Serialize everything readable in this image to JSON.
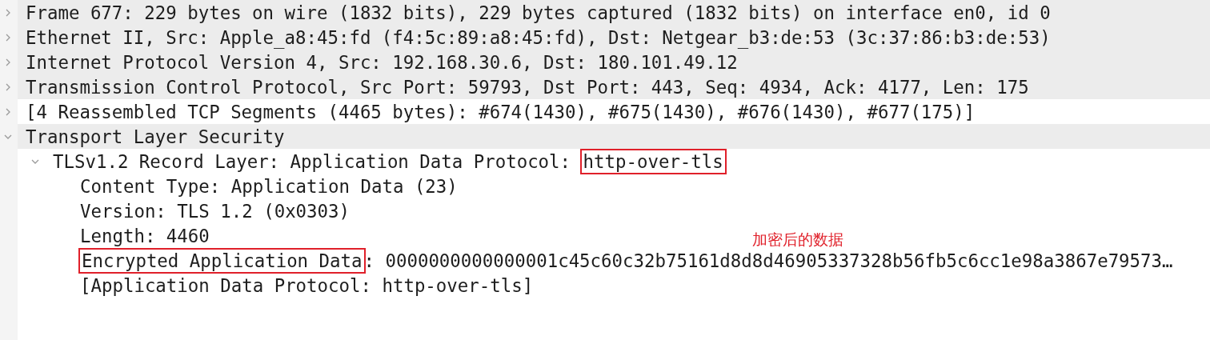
{
  "tree": [
    {
      "expanded": false,
      "shaded": true,
      "segments": [
        {
          "text": "Frame 677: 229 bytes on wire (1832 bits), 229 bytes captured (1832 bits) on interface en0, id 0",
          "annotated": false
        }
      ]
    },
    {
      "expanded": false,
      "shaded": true,
      "segments": [
        {
          "text": "Ethernet II, Src: Apple_a8:45:fd (f4:5c:89:a8:45:fd), Dst: Netgear_b3:de:53 (3c:37:86:b3:de:53)",
          "annotated": false
        }
      ]
    },
    {
      "expanded": false,
      "shaded": true,
      "segments": [
        {
          "text": "Internet Protocol Version 4, Src: 192.168.30.6, Dst: 180.101.49.12",
          "annotated": false
        }
      ]
    },
    {
      "expanded": false,
      "shaded": true,
      "segments": [
        {
          "text": "Transmission Control Protocol, Src Port: 59793, Dst Port: 443, Seq: 4934, Ack: 4177, Len: 175",
          "annotated": false
        }
      ]
    },
    {
      "expanded": false,
      "shaded": false,
      "segments": [
        {
          "text": "[4 Reassembled TCP Segments (4465 bytes): #674(1430), #675(1430), #676(1430), #677(175)]",
          "annotated": false
        }
      ]
    },
    {
      "expanded": true,
      "shaded": true,
      "segments": [
        {
          "text": "Transport Layer Security",
          "annotated": false
        }
      ],
      "children": [
        {
          "expanded": true,
          "shaded": false,
          "segments": [
            {
              "text": "TLSv1.2 Record Layer: Application Data Protocol: ",
              "annotated": false
            },
            {
              "text": "http-over-tls",
              "annotated": true
            }
          ],
          "children": [
            {
              "shaded": false,
              "segments": [
                {
                  "text": "Content Type: Application Data (23)",
                  "annotated": false
                }
              ]
            },
            {
              "shaded": false,
              "segments": [
                {
                  "text": "Version: TLS 1.2 (0x0303)",
                  "annotated": false
                }
              ]
            },
            {
              "shaded": false,
              "segments": [
                {
                  "text": "Length: 4460",
                  "annotated": false
                }
              ]
            },
            {
              "shaded": false,
              "segments": [
                {
                  "text": "Encrypted Application Data",
                  "annotated": true
                },
                {
                  "text": ": 0000000000000001c45c60c32b75161d8d8d46905337328b56fb5c6cc1e98a3867e79573…",
                  "annotated": false
                }
              ],
              "note": "加密后的数据"
            },
            {
              "shaded": false,
              "segments": [
                {
                  "text": "[Application Data Protocol: http-over-tls]",
                  "annotated": false
                }
              ]
            }
          ]
        }
      ]
    }
  ]
}
